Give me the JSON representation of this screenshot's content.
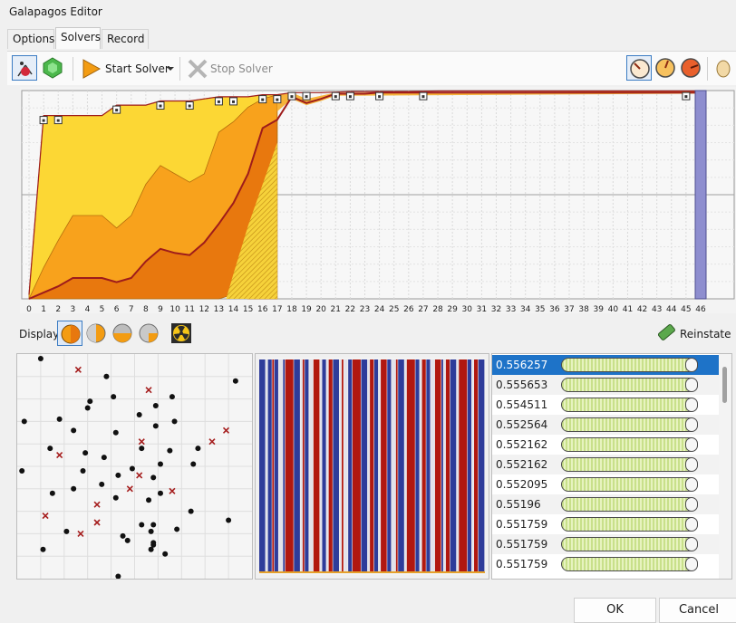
{
  "window": {
    "title": "Galapagos Editor"
  },
  "tabs": [
    {
      "label": "Options"
    },
    {
      "label": "Solvers",
      "active": true
    },
    {
      "label": "Record"
    }
  ],
  "toolbar": {
    "start_label": "Start Solver",
    "stop_label": "Stop Solver",
    "icons": [
      "evolutionary-solver-icon",
      "annealing-solver-icon",
      "start-icon",
      "dropdown-arrow-icon",
      "stop-icon",
      "gauge-slow-icon",
      "gauge-medium-icon",
      "gauge-fast-icon",
      "egg-icon"
    ]
  },
  "chart_data": {
    "type": "area",
    "xlabel": "",
    "ylabel": "",
    "x_ticks": [
      "0",
      "1",
      "2",
      "3",
      "4",
      "5",
      "6",
      "7",
      "8",
      "9",
      "10",
      "11",
      "12",
      "13",
      "14",
      "15",
      "16",
      "17",
      "18",
      "19",
      "20",
      "21",
      "22",
      "23",
      "24",
      "25",
      "26",
      "27",
      "28",
      "29",
      "30",
      "31",
      "32",
      "33",
      "34",
      "35",
      "36",
      "37",
      "38",
      "39",
      "40",
      "41",
      "42",
      "43",
      "44",
      "45",
      "46"
    ],
    "xlim": [
      0,
      46
    ],
    "ylim": [
      0,
      1
    ],
    "highlighted_generation": 46,
    "bands": [
      {
        "color": "#fcd734",
        "x": [
          0,
          1,
          2,
          3,
          4,
          5,
          6,
          7,
          8,
          9,
          10,
          11,
          12,
          13,
          14,
          15,
          16,
          17
        ],
        "upper": [
          0.02,
          0.88,
          0.88,
          0.88,
          0.88,
          0.88,
          0.93,
          0.93,
          0.93,
          0.95,
          0.95,
          0.95,
          0.96,
          0.97,
          0.97,
          0.97,
          0.98,
          0.98
        ],
        "lower": [
          0.0,
          0.02,
          0.04,
          0.08,
          0.1,
          0.12,
          0.16,
          0.2,
          0.24,
          0.3,
          0.34,
          0.4,
          0.48,
          0.56,
          0.64,
          0.72,
          0.8,
          0.9
        ]
      },
      {
        "color": "#f8a21c",
        "x": [
          0,
          1,
          2,
          3,
          4,
          5,
          6,
          7,
          8,
          9,
          10,
          11,
          12,
          13,
          14,
          15,
          16,
          17
        ],
        "upper": [
          0.0,
          0.15,
          0.28,
          0.4,
          0.4,
          0.4,
          0.34,
          0.4,
          0.55,
          0.64,
          0.6,
          0.56,
          0.6,
          0.8,
          0.85,
          0.92,
          0.96,
          0.98
        ],
        "lower": [
          0.0,
          0.01,
          0.02,
          0.04,
          0.05,
          0.05,
          0.05,
          0.06,
          0.06,
          0.07,
          0.08,
          0.1,
          0.2,
          0.3,
          0.35,
          0.5,
          0.65,
          0.75
        ]
      },
      {
        "color": "#e8780e",
        "x": [
          0,
          1,
          2,
          3,
          4,
          5,
          6,
          7,
          8,
          9,
          10,
          11,
          12,
          13,
          14,
          15,
          16,
          17
        ],
        "upper": [
          0.0,
          0.03,
          0.06,
          0.1,
          0.1,
          0.1,
          0.08,
          0.1,
          0.18,
          0.24,
          0.22,
          0.21,
          0.27,
          0.36,
          0.46,
          0.6,
          0.82,
          0.86
        ],
        "lower": [
          0.0,
          0.0,
          0.0,
          0.0,
          0.0,
          0.0,
          0.0,
          0.0,
          0.0,
          0.0,
          0.0,
          0.0,
          0.0,
          0.0,
          0.02,
          0.0,
          0.0,
          0.0
        ]
      }
    ],
    "best_line": {
      "color": "#9e1b1b",
      "x": [
        0,
        1,
        2,
        3,
        4,
        5,
        6,
        7,
        8,
        9,
        10,
        11,
        12,
        13,
        14,
        15,
        16,
        17,
        18,
        19,
        20,
        21,
        22,
        23,
        24,
        25,
        26,
        27,
        28,
        29,
        30,
        35,
        40,
        45,
        46
      ],
      "y": [
        0.0,
        0.03,
        0.06,
        0.1,
        0.1,
        0.1,
        0.08,
        0.1,
        0.18,
        0.24,
        0.22,
        0.21,
        0.27,
        0.36,
        0.46,
        0.6,
        0.82,
        0.86,
        0.97,
        0.94,
        0.96,
        0.985,
        0.985,
        0.985,
        0.99,
        0.99,
        0.99,
        0.99,
        0.99,
        0.99,
        0.99,
        0.99,
        0.99,
        0.99,
        0.99
      ]
    },
    "top_line": {
      "color": "#9e1b1b",
      "x": [
        0,
        1,
        2,
        3,
        4,
        5,
        6,
        7,
        8,
        9,
        10,
        11,
        12,
        13,
        14,
        15,
        16,
        17,
        18,
        20,
        22,
        24,
        26,
        28,
        30,
        35,
        40,
        45,
        46
      ],
      "y": [
        0.02,
        0.88,
        0.88,
        0.88,
        0.88,
        0.88,
        0.93,
        0.93,
        0.93,
        0.95,
        0.95,
        0.95,
        0.96,
        0.97,
        0.97,
        0.97,
        0.98,
        0.98,
        0.99,
        0.99,
        0.995,
        0.995,
        0.995,
        0.998,
        0.998,
        0.998,
        0.998,
        0.998,
        0.998
      ]
    },
    "milestones": [
      1,
      2,
      6,
      9,
      11,
      13,
      14,
      16,
      17,
      18,
      19,
      21,
      22,
      24,
      27,
      45
    ]
  },
  "display": {
    "label": "Display",
    "reinstate_label": "Reinstate",
    "icons": [
      "display-mode-1-icon",
      "display-mode-2-icon",
      "display-mode-3-icon",
      "display-mode-4-icon",
      "radioactive-icon"
    ]
  },
  "scatter": {
    "dots": [
      [
        0.1,
        0.02
      ],
      [
        0.93,
        0.12
      ],
      [
        0.38,
        0.1
      ],
      [
        0.18,
        0.29
      ],
      [
        0.41,
        0.19
      ],
      [
        0.31,
        0.21
      ],
      [
        0.3,
        0.24
      ],
      [
        0.03,
        0.3
      ],
      [
        0.42,
        0.35
      ],
      [
        0.24,
        0.34
      ],
      [
        0.59,
        0.32
      ],
      [
        0.67,
        0.3
      ],
      [
        0.66,
        0.19
      ],
      [
        0.59,
        0.23
      ],
      [
        0.52,
        0.27
      ],
      [
        0.29,
        0.44
      ],
      [
        0.53,
        0.42
      ],
      [
        0.37,
        0.46
      ],
      [
        0.65,
        0.43
      ],
      [
        0.61,
        0.49
      ],
      [
        0.14,
        0.42
      ],
      [
        0.02,
        0.52
      ],
      [
        0.28,
        0.52
      ],
      [
        0.49,
        0.51
      ],
      [
        0.77,
        0.42
      ],
      [
        0.75,
        0.49
      ],
      [
        0.58,
        0.55
      ],
      [
        0.43,
        0.54
      ],
      [
        0.61,
        0.62
      ],
      [
        0.74,
        0.7
      ],
      [
        0.24,
        0.6
      ],
      [
        0.9,
        0.74
      ],
      [
        0.53,
        0.76
      ],
      [
        0.36,
        0.58
      ],
      [
        0.42,
        0.64
      ],
      [
        0.56,
        0.65
      ],
      [
        0.68,
        0.78
      ],
      [
        0.21,
        0.79
      ],
      [
        0.57,
        0.79
      ],
      [
        0.63,
        0.89
      ],
      [
        0.15,
        0.62
      ],
      [
        0.11,
        0.87
      ],
      [
        0.58,
        0.84
      ],
      [
        0.57,
        0.87
      ],
      [
        0.58,
        0.76
      ],
      [
        0.58,
        0.85
      ],
      [
        0.45,
        0.81
      ],
      [
        0.47,
        0.83
      ],
      [
        0.43,
        0.99
      ]
    ],
    "crosses": [
      [
        0.26,
        0.07
      ],
      [
        0.56,
        0.16
      ],
      [
        0.89,
        0.34
      ],
      [
        0.83,
        0.39
      ],
      [
        0.53,
        0.39
      ],
      [
        0.18,
        0.45
      ],
      [
        0.52,
        0.54
      ],
      [
        0.48,
        0.6
      ],
      [
        0.66,
        0.61
      ],
      [
        0.34,
        0.67
      ],
      [
        0.12,
        0.72
      ],
      [
        0.34,
        0.75
      ],
      [
        0.27,
        0.8
      ]
    ]
  },
  "bars": {
    "pattern": [
      [
        "b",
        3
      ],
      [
        "w",
        1
      ],
      [
        "b",
        2
      ],
      [
        "r",
        1
      ],
      [
        "b",
        2
      ],
      [
        "w",
        2
      ],
      [
        "b",
        1
      ],
      [
        "r",
        4
      ],
      [
        "b",
        3
      ],
      [
        "w",
        1
      ],
      [
        "r",
        1
      ],
      [
        "b",
        2
      ],
      [
        "w",
        2
      ],
      [
        "r",
        3
      ],
      [
        "w",
        1
      ],
      [
        "b",
        2
      ],
      [
        "w",
        1
      ],
      [
        "r",
        2
      ],
      [
        "b",
        3
      ],
      [
        "w",
        1
      ],
      [
        "r",
        1
      ],
      [
        "w",
        2
      ],
      [
        "b",
        2
      ],
      [
        "r",
        4
      ],
      [
        "b",
        3
      ],
      [
        "w",
        1
      ],
      [
        "r",
        2
      ],
      [
        "b",
        2
      ],
      [
        "w",
        1
      ],
      [
        "r",
        3
      ],
      [
        "b",
        2
      ],
      [
        "w",
        2
      ],
      [
        "r",
        1
      ],
      [
        "b",
        3
      ],
      [
        "w",
        1
      ],
      [
        "r",
        4
      ],
      [
        "b",
        2
      ],
      [
        "w",
        1
      ],
      [
        "r",
        2
      ],
      [
        "b",
        2
      ],
      [
        "w",
        2
      ],
      [
        "r",
        3
      ],
      [
        "b",
        1
      ],
      [
        "w",
        1
      ],
      [
        "r",
        2
      ],
      [
        "b",
        3
      ],
      [
        "w",
        1
      ],
      [
        "r",
        4
      ],
      [
        "b",
        2
      ],
      [
        "w",
        1
      ],
      [
        "r",
        2
      ],
      [
        "b",
        3
      ]
    ]
  },
  "genomes": [
    {
      "value": "0.556257",
      "fill": 0.98,
      "selected": true
    },
    {
      "value": "0.555653",
      "fill": 0.98
    },
    {
      "value": "0.554511",
      "fill": 0.98
    },
    {
      "value": "0.552564",
      "fill": 0.98
    },
    {
      "value": "0.552162",
      "fill": 0.98
    },
    {
      "value": "0.552162",
      "fill": 0.98
    },
    {
      "value": "0.552095",
      "fill": 0.98
    },
    {
      "value": "0.55196",
      "fill": 0.98
    },
    {
      "value": "0.551759",
      "fill": 0.98
    },
    {
      "value": "0.551759",
      "fill": 0.98
    },
    {
      "value": "0.551759",
      "fill": 0.98
    }
  ],
  "buttons": {
    "ok": "OK",
    "cancel": "Cancel"
  }
}
